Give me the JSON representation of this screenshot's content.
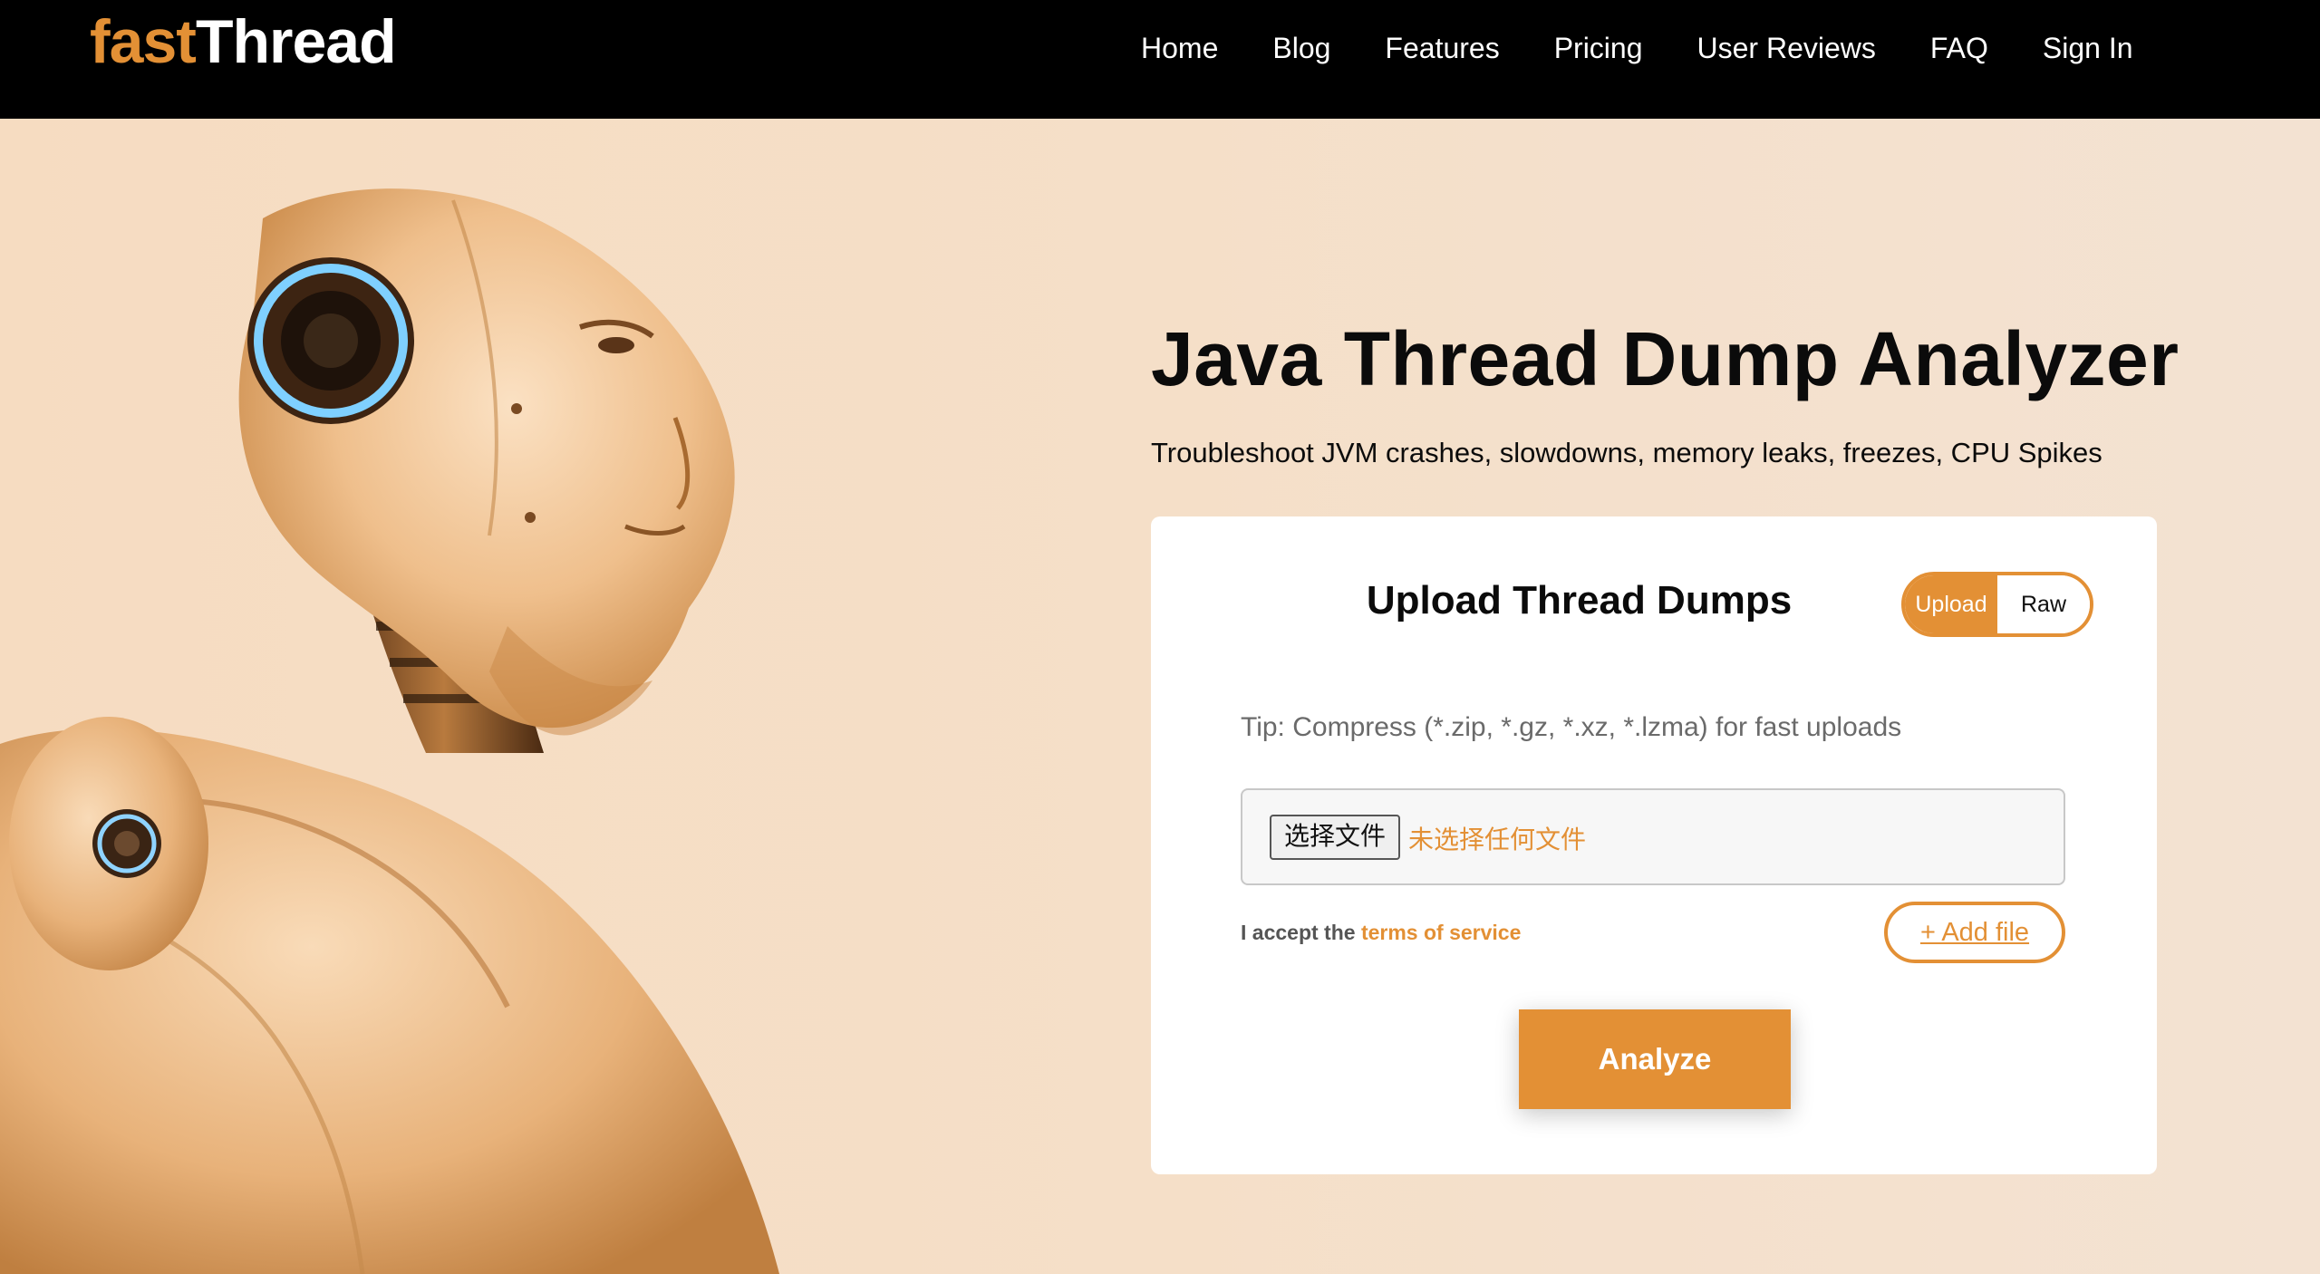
{
  "header": {
    "logo_part1": "fast",
    "logo_part2": "Thread",
    "nav": [
      "Home",
      "Blog",
      "Features",
      "Pricing",
      "User Reviews",
      "FAQ",
      "Sign In"
    ]
  },
  "hero": {
    "title": "Java Thread Dump Analyzer",
    "subtitle": "Troubleshoot JVM crashes, slowdowns, memory leaks, freezes, CPU Spikes"
  },
  "upload_card": {
    "title": "Upload Thread Dumps",
    "toggle": {
      "upload": "Upload",
      "raw": "Raw",
      "selected": "Upload"
    },
    "tip": "Tip: Compress (*.zip, *.gz, *.xz, *.lzma) for fast uploads",
    "file_button": "选择文件",
    "file_status": "未选择任何文件",
    "terms_prefix": "I accept the ",
    "terms_link": "terms of service",
    "add_file": "+ Add file",
    "analyze": "Analyze"
  },
  "colors": {
    "accent": "#e39035",
    "header_bg": "#000000",
    "page_bg": "#f5dfc8"
  }
}
